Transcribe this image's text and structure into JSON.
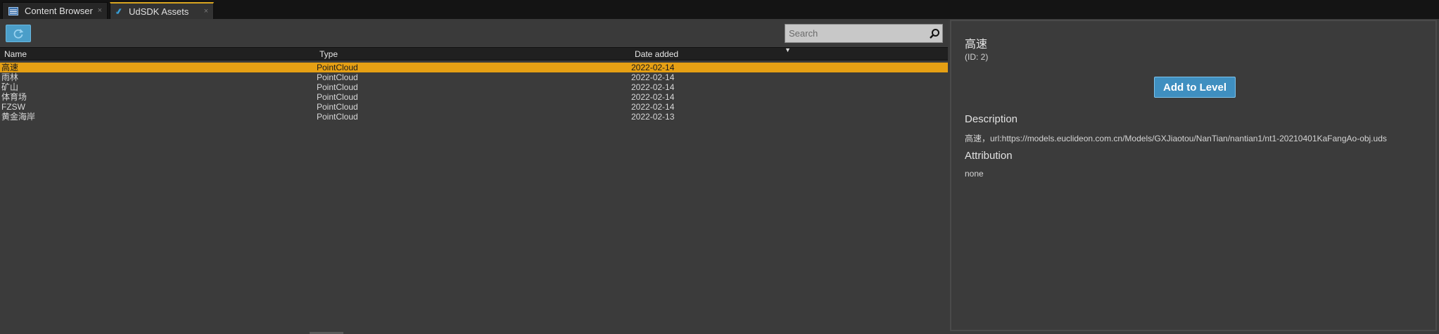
{
  "tabs": [
    {
      "label": "Content Browser",
      "icon": "content-browser-icon",
      "close": "×"
    },
    {
      "label": "UdSDK Assets",
      "icon": "udsdk-icon",
      "close": "×"
    }
  ],
  "toolbar": {
    "refresh_icon": "refresh-icon",
    "search_placeholder": "Search",
    "search_icon": "magnifier-icon"
  },
  "table": {
    "columns": [
      "Name",
      "Type",
      "Date added"
    ],
    "sort_indicator": "▼",
    "rows": [
      {
        "name": "高速",
        "type": "PointCloud",
        "date": "2022-02-14",
        "selected": true
      },
      {
        "name": "雨林",
        "type": "PointCloud",
        "date": "2022-02-14"
      },
      {
        "name": "矿山",
        "type": "PointCloud",
        "date": "2022-02-14"
      },
      {
        "name": "体育场",
        "type": "PointCloud",
        "date": "2022-02-14"
      },
      {
        "name": "FZSW",
        "type": "PointCloud",
        "date": "2022-02-14"
      },
      {
        "name": "黄金海岸",
        "type": "PointCloud",
        "date": "2022-02-13"
      }
    ]
  },
  "details": {
    "title": "高速",
    "id": "(ID: 2)",
    "add_button": "Add to Level",
    "description_heading": "Description",
    "description": "高速，url:https://models.euclideon.com.cn/Models/GXJiaotou/NanTian/nantian1/nt1-20210401KaFangAo-obj.uds",
    "attribution_heading": "Attribution",
    "attribution": "none"
  },
  "colors": {
    "selection": "#e6a014",
    "accent_button": "#3f8fc0",
    "tab_highlight": "#d9a520"
  }
}
